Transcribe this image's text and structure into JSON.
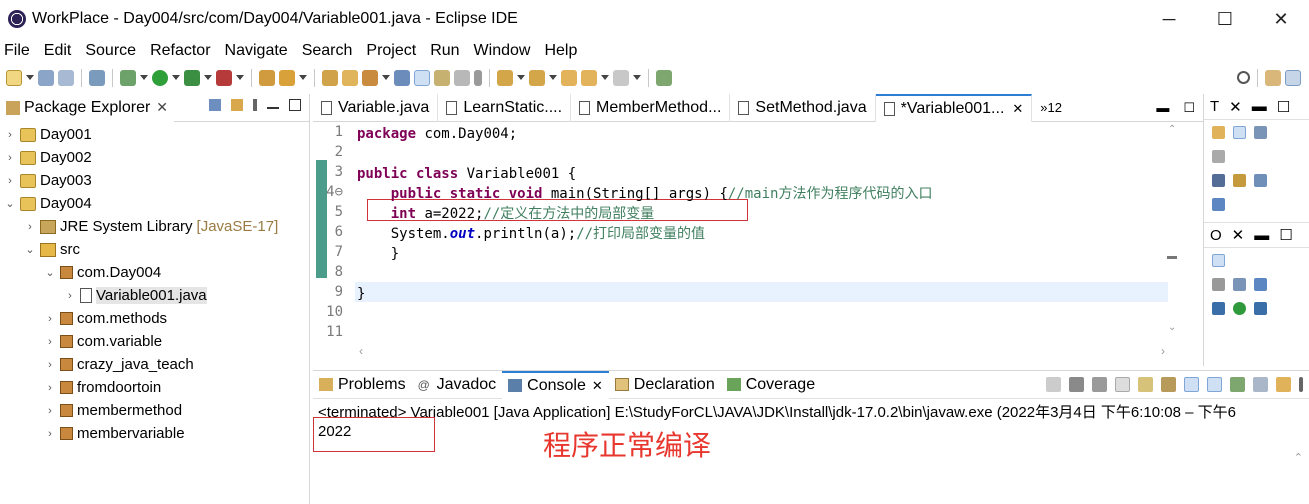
{
  "window": {
    "title": "WorkPlace - Day004/src/com/Day004/Variable001.java - Eclipse IDE",
    "controls": [
      "─",
      "☐",
      "✕"
    ]
  },
  "menu": [
    "File",
    "Edit",
    "Source",
    "Refactor",
    "Navigate",
    "Search",
    "Project",
    "Run",
    "Window",
    "Help"
  ],
  "package_explorer": {
    "tab_label": "Package Explorer",
    "tree": [
      {
        "label": "Day001",
        "depth": 0,
        "chevron": "›",
        "icon": "project-icon"
      },
      {
        "label": "Day002",
        "depth": 0,
        "chevron": "›",
        "icon": "project-icon"
      },
      {
        "label": "Day003",
        "depth": 0,
        "chevron": "›",
        "icon": "project-icon"
      },
      {
        "label": "Day004",
        "depth": 0,
        "chevron": "⌄",
        "icon": "project-icon"
      },
      {
        "label": "JRE System Library",
        "suffix": "[JavaSE-17]",
        "depth": 1,
        "chevron": "›",
        "icon": "library-icon"
      },
      {
        "label": "src",
        "depth": 1,
        "chevron": "⌄",
        "icon": "source-folder-icon"
      },
      {
        "label": "com.Day004",
        "depth": 2,
        "chevron": "⌄",
        "icon": "package-icon"
      },
      {
        "label": "Variable001.java",
        "depth": 3,
        "chevron": "›",
        "icon": "java-file-icon",
        "selected": true
      },
      {
        "label": "com.methods",
        "depth": 2,
        "chevron": "›",
        "icon": "package-icon"
      },
      {
        "label": "com.variable",
        "depth": 2,
        "chevron": "›",
        "icon": "package-icon"
      },
      {
        "label": "crazy_java_teach",
        "depth": 2,
        "chevron": "›",
        "icon": "package-icon"
      },
      {
        "label": "fromdoortoin",
        "depth": 2,
        "chevron": "›",
        "icon": "package-icon"
      },
      {
        "label": "membermethod",
        "depth": 2,
        "chevron": "›",
        "icon": "package-icon"
      },
      {
        "label": "membervariable",
        "depth": 2,
        "chevron": "›",
        "icon": "package-icon"
      }
    ]
  },
  "editor": {
    "tabs": [
      "Variable.java",
      "LearnStatic....",
      "MemberMethod...",
      "SetMethod.java",
      "*Variable001..."
    ],
    "overflow": "»12",
    "line_numbers": [
      "1",
      "2",
      "3",
      "4⊖",
      "5",
      "6",
      "7",
      "8",
      "9",
      "10",
      "11"
    ],
    "lines": [
      {
        "kw": "package",
        "rest": " com.Day004;"
      },
      {},
      {
        "kw": "public class",
        "rest": " Variable001 {"
      },
      {
        "indent": "    ",
        "kw": "public static void",
        "rest": " main(String[] args) {",
        "comment": "//main方法作为程序代码的入口"
      },
      {
        "indent": "    ",
        "kw": "int",
        "rest": " a=2022;",
        "comment": "//定义在方法中的局部变量"
      },
      {
        "indent": "    ",
        "rest": "System.",
        "field": "out",
        "rest2": ".println(a);",
        "comment": "//打印局部变量的值"
      },
      {
        "indent": "    ",
        "rest": "}"
      },
      {},
      {
        "rest": "}"
      },
      {},
      {}
    ]
  },
  "right_panels": {
    "top_label": "T",
    "mid_label": "O",
    "close": "✕"
  },
  "console": {
    "tabs": [
      "Problems",
      "Javadoc",
      "Console",
      "Declaration",
      "Coverage"
    ],
    "status": "<terminated> Variable001 [Java Application] E:\\StudyForCL\\JAVA\\JDK\\Install\\jdk-17.0.2\\bin\\javaw.exe  (2022年3月4日 下午6:10:08 – 下午6",
    "output": "2022",
    "annotation": "程序正常编译"
  }
}
